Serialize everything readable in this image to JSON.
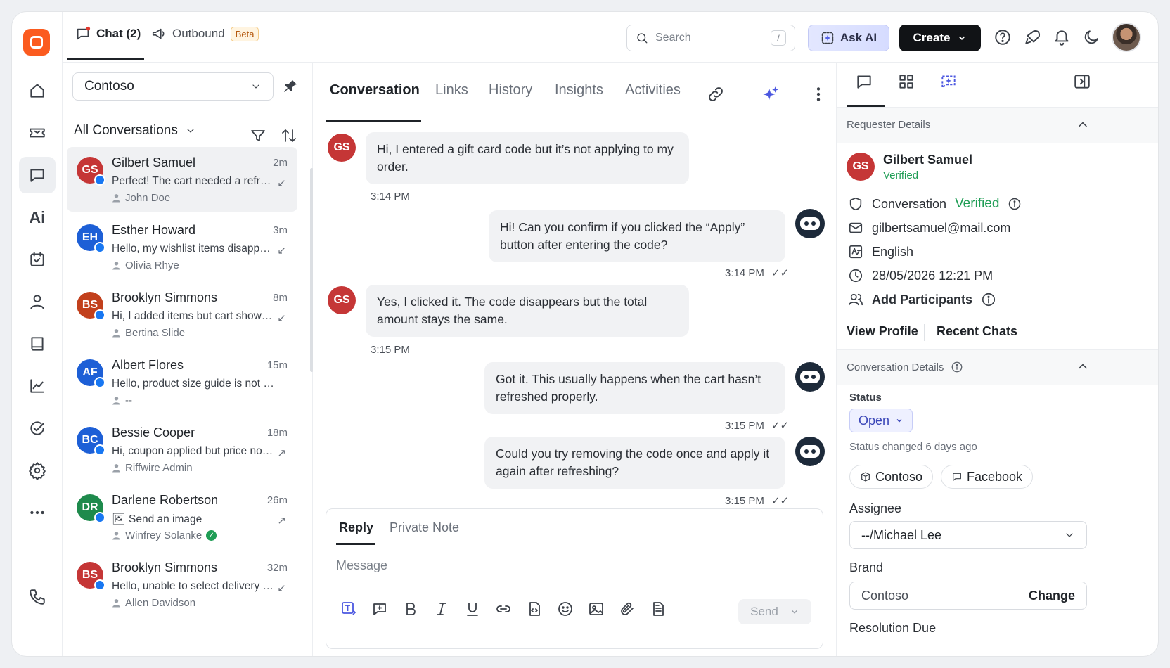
{
  "topbar": {
    "chat_tab": "Chat (2)",
    "outbound_tab": "Outbound",
    "beta_badge": "Beta",
    "search_placeholder": "Search",
    "search_shortcut": "/",
    "ask_ai": "Ask AI",
    "create": "Create"
  },
  "rail": {
    "ai_label": "Ai"
  },
  "list": {
    "workspace": "Contoso",
    "filter_label": "All Conversations",
    "conversations": [
      {
        "initials": "GS",
        "name": "Gilbert Samuel",
        "time": "2m",
        "preview": "Perfect! The cart needed a refresh",
        "agent": "John Doe",
        "direction": "↙",
        "color": "#c53636"
      },
      {
        "initials": "EH",
        "name": "Esther Howard",
        "time": "3m",
        "preview": "Hello, my wishlist items disappeared",
        "agent": "Olivia Rhye",
        "direction": "↙",
        "color": "#1d5fd6"
      },
      {
        "initials": "BS",
        "name": "Brooklyn Simmons",
        "time": "8m",
        "preview": "Hi, I added items but cart shows empty",
        "agent": "Bertina Slide",
        "direction": "↙",
        "color": "#c2401c"
      },
      {
        "initials": "AF",
        "name": "Albert Flores",
        "time": "15m",
        "preview": "Hello, product size guide is not loading",
        "agent": "--",
        "direction": "",
        "color": "#1d5fd6"
      },
      {
        "initials": "BC",
        "name": "Bessie Cooper",
        "time": "18m",
        "preview": "Hi, coupon applied but price not updated",
        "agent": "Riffwire Admin",
        "direction": "↗",
        "color": "#1d5fd6"
      },
      {
        "initials": "DR",
        "name": "Darlene Robertson",
        "time": "26m",
        "preview": "Send an image",
        "agent": "Winfrey Solanke",
        "direction": "↗",
        "color": "#1e8a4c"
      },
      {
        "initials": "BS",
        "name": "Brooklyn Simmons",
        "time": "32m",
        "preview": "Hello, unable to select delivery slot",
        "agent": "Allen Davidson",
        "direction": "↙",
        "color": "#c53636"
      }
    ]
  },
  "conversation": {
    "tabs": [
      "Conversation",
      "Links",
      "History",
      "Insights",
      "Activities"
    ],
    "messages": [
      {
        "from": "customer",
        "initials": "GS",
        "text": "Hi, I entered a gift card code but it’s not applying to my order.",
        "time": "3:14 PM"
      },
      {
        "from": "bot",
        "text": "Hi! Can you confirm if you clicked the “Apply” button after entering the code?",
        "time": "3:14 PM"
      },
      {
        "from": "customer",
        "initials": "GS",
        "text": "Yes, I clicked it. The code disappears but the total amount stays the same.",
        "time": "3:15 PM"
      },
      {
        "from": "bot",
        "text": "Got it. This usually happens when the cart hasn’t refreshed properly.",
        "time": "3:15 PM"
      },
      {
        "from": "bot",
        "text": "Could you try removing the code once and apply it again after refreshing?",
        "time": "3:15 PM"
      }
    ],
    "reply_tab": "Reply",
    "note_tab": "Private Note",
    "message_placeholder": "Message",
    "send": "Send"
  },
  "requester": {
    "section_title": "Requester Details",
    "initials": "GS",
    "name": "Gilbert Samuel",
    "verified": "Verified",
    "conversation_label": "Conversation",
    "conversation_verified": "Verified",
    "email": "gilbertsamuel@mail.com",
    "language": "English",
    "datetime": "28/05/2026 12:21 PM",
    "add_participants": "Add Participants",
    "view_profile": "View Profile",
    "recent_chats": "Recent Chats"
  },
  "details": {
    "section_title": "Conversation Details",
    "status_label": "Status",
    "status_value": "Open",
    "status_changed": "Status changed 6 days ago",
    "channel_brand": "Contoso",
    "channel_source": "Facebook",
    "assignee_label": "Assignee",
    "assignee_value": "--/Michael Lee",
    "brand_label": "Brand",
    "brand_value": "Contoso",
    "brand_change": "Change",
    "resolution_label": "Resolution Due"
  }
}
